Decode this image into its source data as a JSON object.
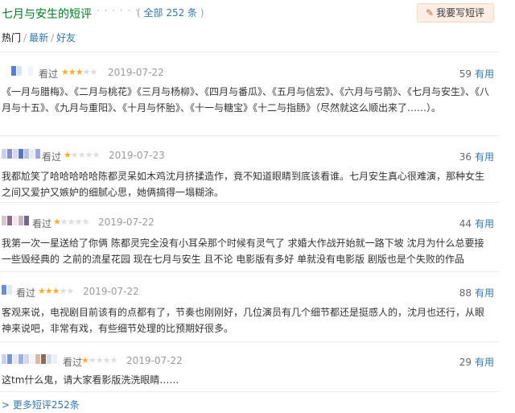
{
  "header": {
    "title": "七月与安生的短评",
    "dots": "· · · · · ·",
    "count_open": "( ",
    "count_link": "全部 252 条",
    "count_close": " )",
    "write_button": "我要写短评",
    "write_icon": "pencil-icon"
  },
  "tabs": {
    "hot": "热门",
    "sep1": "/",
    "latest": "最新",
    "sep2": "/",
    "friends": "好友"
  },
  "comments": [
    {
      "seen": "看过",
      "stars_on": "★★★",
      "stars_off": "★★",
      "rating": 3,
      "date": "2019-07-22",
      "votes": "59",
      "useful": "有用",
      "text": "《一月与腊梅》、《二月与桃花》《三月与杨柳》、《四月与番瓜》、《五月与信宏》、《六月与弓箭》、《七月与安生》、《八月与十五》、《九月与重阳》、《十月与怀胎》、《十一与糖宝》《十二与指肠》（尽然就这么顺出来了……）。"
    },
    {
      "seen": "看过",
      "stars_on": "★",
      "stars_off": "★★★★",
      "rating": 1,
      "date": "2019-07-23",
      "votes": "36",
      "useful": "有用",
      "text": "我都尬笑了哈哈哈哈哈陈都灵呆如木鸡沈月挤揉造作，竟不知道眼睛到底该看谁。七月安生真心很难演，那种女生之间又爱护又嫉妒的细腻心思，她俩搞得一塌糊涂。"
    },
    {
      "seen": "看过",
      "stars_on": "★",
      "stars_off": "★★★★",
      "rating": 1,
      "date": "2019-07-22",
      "votes": "44",
      "useful": "有用",
      "text": "我第一次一星送给了你俩 陈都灵完全没有小耳朵那个时候有灵气了 求婚大作战开始就一路下坡 沈月为什么总要接一些毁经典的 之前的流星花园 现在七月与安生 且不论 电影版有多好 单就没有电影版 剧版也是个失败的作品"
    },
    {
      "seen": "看过",
      "stars_on": "★★★",
      "stars_off": "★★",
      "rating": 3,
      "date": "2019-07-22",
      "votes": "88",
      "useful": "有用",
      "text": "客观来说，电视剧目前该有的点都有了，节奏也刚刚好，几位演员有几个细节都还是挺感人的，沈月也还行，从眼神来说吧，非常有戏，有些细节处理的比预期好很多。"
    },
    {
      "seen": "看过",
      "stars_on": "★",
      "stars_off": "★★★★",
      "rating": 1,
      "date": "2019-07-22",
      "votes": "29",
      "useful": "有用",
      "text": "这tm什么鬼，请大家看影版洗洗眼睛……"
    }
  ],
  "more_link": "> 更多短评252条",
  "colors": {
    "title_green": "#007722",
    "link_blue": "#3377aa",
    "star_orange": "#ffac2d",
    "button_bg": "#fdeee5"
  }
}
